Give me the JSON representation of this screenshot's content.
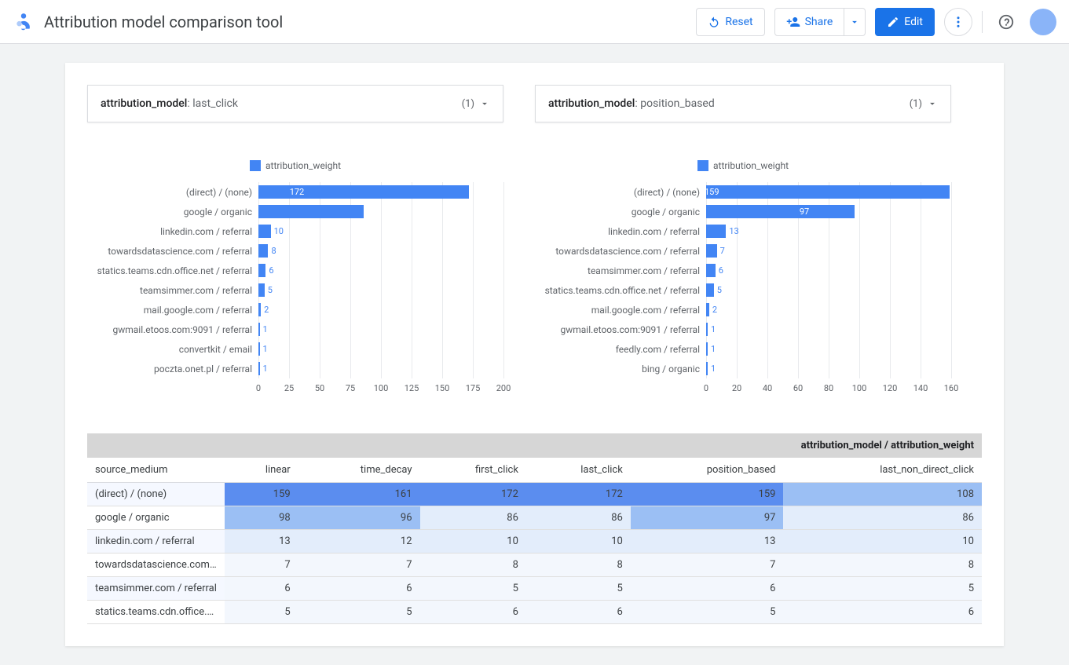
{
  "header": {
    "title": "Attribution model comparison tool",
    "reset": "Reset",
    "share": "Share",
    "edit": "Edit"
  },
  "panels": [
    {
      "filter_key": "attribution_model",
      "filter_value": "last_click",
      "count": "(1)"
    },
    {
      "filter_key": "attribution_model",
      "filter_value": "position_based",
      "count": "(1)"
    }
  ],
  "legend_label": "attribution_weight",
  "chart_data": [
    {
      "type": "bar",
      "title": "attribution_model: last_click",
      "xlabel": "",
      "ylabel": "",
      "xlim": [
        0,
        200
      ],
      "ticks": [
        0,
        25,
        50,
        75,
        100,
        125,
        150,
        175,
        200
      ],
      "categories": [
        "(direct) / (none)",
        "google / organic",
        "linkedin.com / referral",
        "towardsdatascience.com / referral",
        "statics.teams.cdn.office.net / referral",
        "teamsimmer.com / referral",
        "mail.google.com / referral",
        "gwmail.etoos.com:9091 / referral",
        "convertkit / email",
        "poczta.onet.pl / referral"
      ],
      "values": [
        172,
        86,
        10,
        8,
        6,
        5,
        2,
        1,
        1,
        1
      ]
    },
    {
      "type": "bar",
      "title": "attribution_model: position_based",
      "xlabel": "",
      "ylabel": "",
      "xlim": [
        0,
        160
      ],
      "ticks": [
        0,
        20,
        40,
        60,
        80,
        100,
        120,
        140,
        160
      ],
      "categories": [
        "(direct) / (none)",
        "google / organic",
        "linkedin.com / referral",
        "towardsdatascience.com / referral",
        "teamsimmer.com / referral",
        "statics.teams.cdn.office.net / referral",
        "mail.google.com / referral",
        "gwmail.etoos.com:9091 / referral",
        "feedly.com / referral",
        "bing / organic"
      ],
      "values": [
        159,
        97,
        13,
        7,
        6,
        5,
        2,
        1,
        1,
        1
      ]
    }
  ],
  "table": {
    "super_header": "attribution_model / attribution_weight",
    "row_header": "source_medium",
    "columns": [
      "linear",
      "time_decay",
      "first_click",
      "last_click",
      "position_based",
      "last_non_direct_click"
    ],
    "rows": [
      {
        "label": "(direct) / (none)",
        "cells": [
          159,
          161,
          172,
          172,
          159,
          108
        ]
      },
      {
        "label": "google / organic",
        "cells": [
          98,
          96,
          86,
          86,
          97,
          86
        ]
      },
      {
        "label": "linkedin.com / referral",
        "cells": [
          13,
          12,
          10,
          10,
          13,
          10
        ]
      },
      {
        "label": "towardsdatascience.com / r...",
        "cells": [
          7,
          7,
          8,
          8,
          7,
          8
        ]
      },
      {
        "label": "teamsimmer.com / referral",
        "cells": [
          6,
          6,
          5,
          5,
          6,
          5
        ]
      },
      {
        "label": "statics.teams.cdn.office.net ...",
        "cells": [
          5,
          5,
          6,
          6,
          5,
          6
        ]
      }
    ],
    "heat_max": 172
  }
}
